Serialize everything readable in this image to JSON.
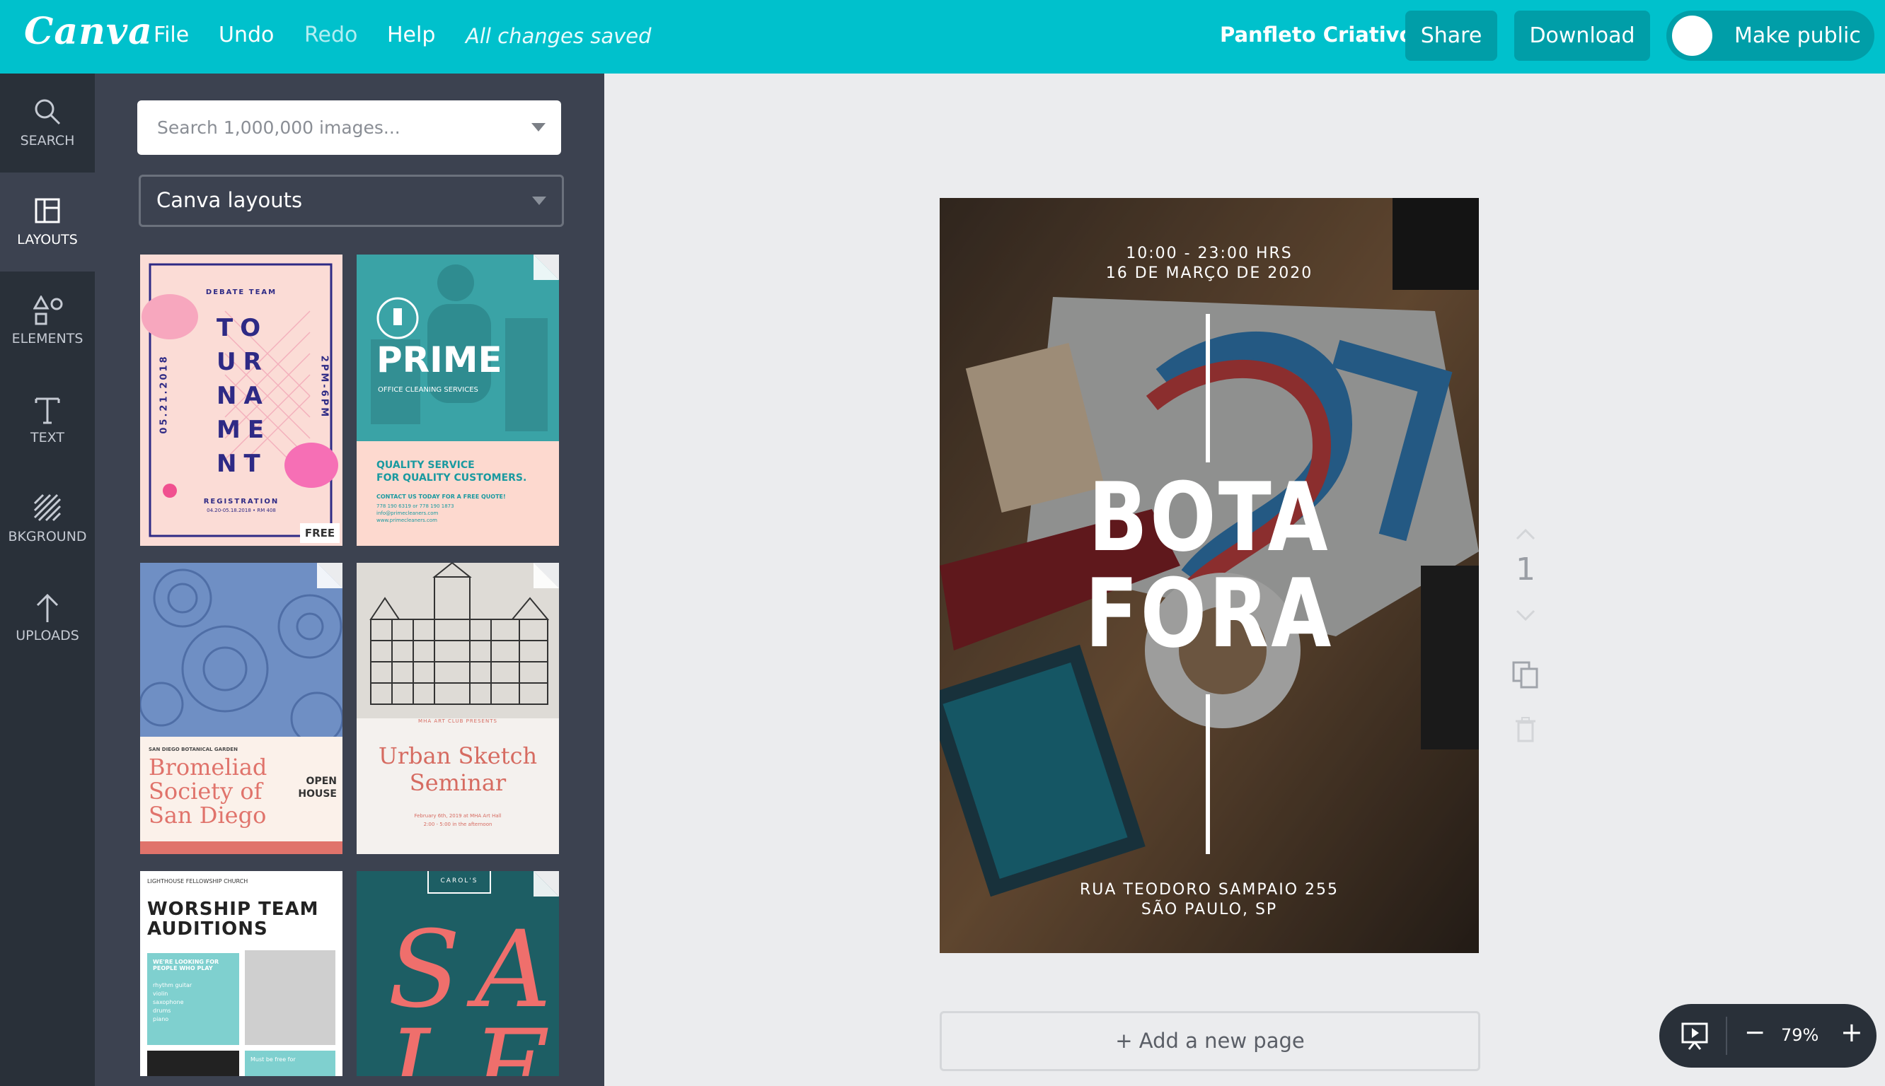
{
  "app": {
    "logo": "Canva",
    "menu": {
      "file": "File",
      "undo": "Undo",
      "redo": "Redo",
      "help": "Help"
    },
    "save_status": "All changes saved",
    "doc_title": "Panfleto Criativo",
    "share_label": "Share",
    "download_label": "Download",
    "make_public_label": "Make public",
    "accent_color": "#00c1cc"
  },
  "sidebar": {
    "items": [
      {
        "label": "SEARCH",
        "icon": "search-icon"
      },
      {
        "label": "LAYOUTS",
        "icon": "layouts-icon",
        "active": true
      },
      {
        "label": "ELEMENTS",
        "icon": "shapes-icon"
      },
      {
        "label": "TEXT",
        "icon": "text-icon"
      },
      {
        "label": "BKGROUND",
        "icon": "background-icon"
      },
      {
        "label": "UPLOADS",
        "icon": "upload-icon"
      }
    ]
  },
  "panel": {
    "search_placeholder": "Search 1,000,000 images...",
    "layout_select": "Canva layouts",
    "layouts": {
      "tournament": {
        "header": "DEBATE TEAM",
        "title_lines": [
          "TO",
          "UR",
          "NA",
          "ME",
          "NT"
        ],
        "left_date": "05.21.2018",
        "right_time": "2PM-6PM",
        "footer": "REGISTRATION",
        "footer_sub": "04.20-05.18.2018 • RM 408",
        "badge": "FREE"
      },
      "prime": {
        "title": "PRIME",
        "subtitle": "OFFICE CLEANING SERVICES",
        "tagline_1": "QUALITY SERVICE",
        "tagline_2": "FOR QUALITY CUSTOMERS.",
        "contact": "CONTACT US TODAY FOR A FREE QUOTE!",
        "phones": "778 190 6319 or 778 190 1873",
        "email": "info@primecleaners.com",
        "web": "www.primecleaners.com"
      },
      "bromeliad": {
        "header": "SAN DIEGO BOTANICAL GARDEN",
        "title_1": "Bromeliad",
        "title_2": "Society of",
        "title_3": "San Diego",
        "open_1": "OPEN",
        "open_2": "HOUSE"
      },
      "urban": {
        "header": "MHA ART CLUB PRESENTS",
        "title_1": "Urban Sketch",
        "title_2": "Seminar",
        "details": "February 6th, 2019 at MHA Art Hall",
        "time": "2:00 - 5:00 in the afternoon"
      },
      "worship": {
        "header": "LIGHTHOUSE FELLOWSHIP CHURCH",
        "title_1": "WORSHIP TEAM",
        "title_2": "AUDITIONS",
        "box_title": "WE'RE LOOKING FOR PEOPLE WHO PLAY",
        "instruments": [
          "rhythm guitar",
          "violin",
          "saxophone",
          "drums",
          "piano"
        ],
        "footer": "Must be free for"
      },
      "sale": {
        "header": "CAROL'S",
        "title": "SA",
        "title_2": "LE"
      }
    }
  },
  "canvas": {
    "time": "10:00 - 23:00 HRS",
    "date": "16 DE MARÇO DE 2020",
    "title_1": "BOTA",
    "title_2": "FORA",
    "address_1": "RUA TEODORO SAMPAIO 255",
    "address_2": "SÃO PAULO, SP",
    "page_number": "1",
    "add_page": "+ Add a new page"
  },
  "zoom": {
    "minus": "−",
    "value": "79%",
    "plus": "+"
  }
}
